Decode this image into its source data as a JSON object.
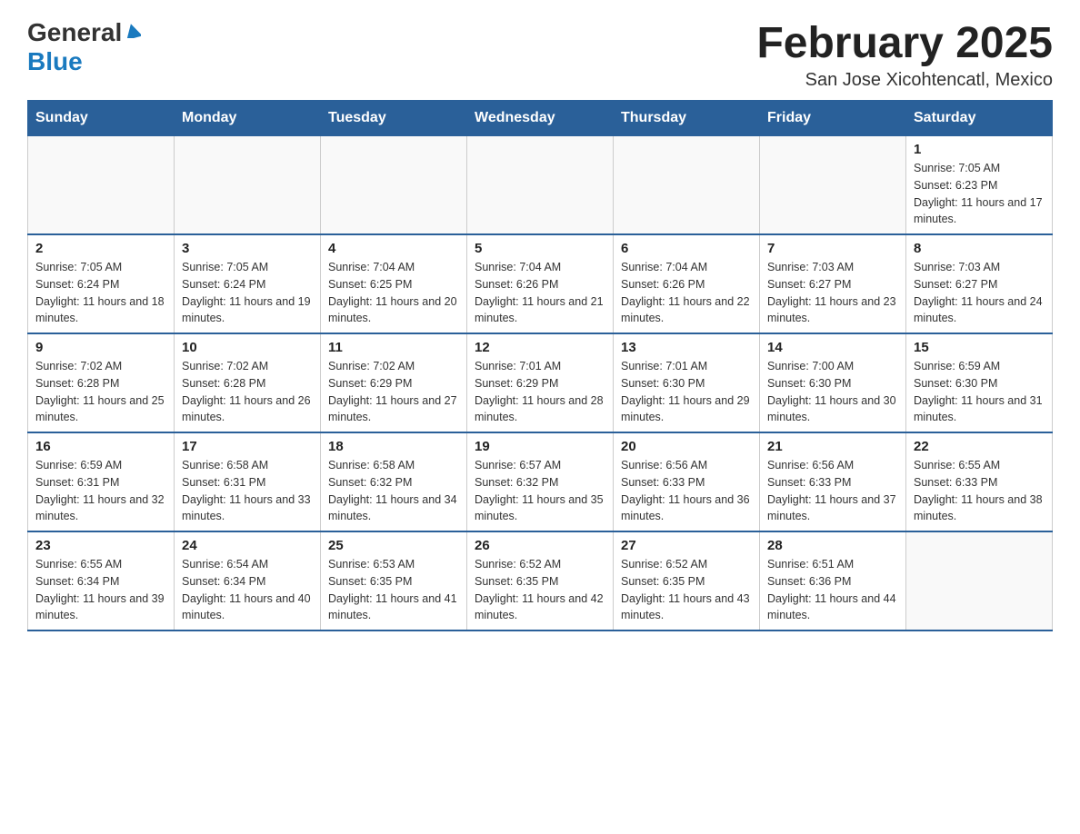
{
  "header": {
    "logo": {
      "general": "General",
      "blue": "Blue"
    },
    "title": "February 2025",
    "location": "San Jose Xicohtencatl, Mexico"
  },
  "weekdays": [
    "Sunday",
    "Monday",
    "Tuesday",
    "Wednesday",
    "Thursday",
    "Friday",
    "Saturday"
  ],
  "weeks": [
    [
      {
        "day": "",
        "info": ""
      },
      {
        "day": "",
        "info": ""
      },
      {
        "day": "",
        "info": ""
      },
      {
        "day": "",
        "info": ""
      },
      {
        "day": "",
        "info": ""
      },
      {
        "day": "",
        "info": ""
      },
      {
        "day": "1",
        "info": "Sunrise: 7:05 AM\nSunset: 6:23 PM\nDaylight: 11 hours and 17 minutes."
      }
    ],
    [
      {
        "day": "2",
        "info": "Sunrise: 7:05 AM\nSunset: 6:24 PM\nDaylight: 11 hours and 18 minutes."
      },
      {
        "day": "3",
        "info": "Sunrise: 7:05 AM\nSunset: 6:24 PM\nDaylight: 11 hours and 19 minutes."
      },
      {
        "day": "4",
        "info": "Sunrise: 7:04 AM\nSunset: 6:25 PM\nDaylight: 11 hours and 20 minutes."
      },
      {
        "day": "5",
        "info": "Sunrise: 7:04 AM\nSunset: 6:26 PM\nDaylight: 11 hours and 21 minutes."
      },
      {
        "day": "6",
        "info": "Sunrise: 7:04 AM\nSunset: 6:26 PM\nDaylight: 11 hours and 22 minutes."
      },
      {
        "day": "7",
        "info": "Sunrise: 7:03 AM\nSunset: 6:27 PM\nDaylight: 11 hours and 23 minutes."
      },
      {
        "day": "8",
        "info": "Sunrise: 7:03 AM\nSunset: 6:27 PM\nDaylight: 11 hours and 24 minutes."
      }
    ],
    [
      {
        "day": "9",
        "info": "Sunrise: 7:02 AM\nSunset: 6:28 PM\nDaylight: 11 hours and 25 minutes."
      },
      {
        "day": "10",
        "info": "Sunrise: 7:02 AM\nSunset: 6:28 PM\nDaylight: 11 hours and 26 minutes."
      },
      {
        "day": "11",
        "info": "Sunrise: 7:02 AM\nSunset: 6:29 PM\nDaylight: 11 hours and 27 minutes."
      },
      {
        "day": "12",
        "info": "Sunrise: 7:01 AM\nSunset: 6:29 PM\nDaylight: 11 hours and 28 minutes."
      },
      {
        "day": "13",
        "info": "Sunrise: 7:01 AM\nSunset: 6:30 PM\nDaylight: 11 hours and 29 minutes."
      },
      {
        "day": "14",
        "info": "Sunrise: 7:00 AM\nSunset: 6:30 PM\nDaylight: 11 hours and 30 minutes."
      },
      {
        "day": "15",
        "info": "Sunrise: 6:59 AM\nSunset: 6:30 PM\nDaylight: 11 hours and 31 minutes."
      }
    ],
    [
      {
        "day": "16",
        "info": "Sunrise: 6:59 AM\nSunset: 6:31 PM\nDaylight: 11 hours and 32 minutes."
      },
      {
        "day": "17",
        "info": "Sunrise: 6:58 AM\nSunset: 6:31 PM\nDaylight: 11 hours and 33 minutes."
      },
      {
        "day": "18",
        "info": "Sunrise: 6:58 AM\nSunset: 6:32 PM\nDaylight: 11 hours and 34 minutes."
      },
      {
        "day": "19",
        "info": "Sunrise: 6:57 AM\nSunset: 6:32 PM\nDaylight: 11 hours and 35 minutes."
      },
      {
        "day": "20",
        "info": "Sunrise: 6:56 AM\nSunset: 6:33 PM\nDaylight: 11 hours and 36 minutes."
      },
      {
        "day": "21",
        "info": "Sunrise: 6:56 AM\nSunset: 6:33 PM\nDaylight: 11 hours and 37 minutes."
      },
      {
        "day": "22",
        "info": "Sunrise: 6:55 AM\nSunset: 6:33 PM\nDaylight: 11 hours and 38 minutes."
      }
    ],
    [
      {
        "day": "23",
        "info": "Sunrise: 6:55 AM\nSunset: 6:34 PM\nDaylight: 11 hours and 39 minutes."
      },
      {
        "day": "24",
        "info": "Sunrise: 6:54 AM\nSunset: 6:34 PM\nDaylight: 11 hours and 40 minutes."
      },
      {
        "day": "25",
        "info": "Sunrise: 6:53 AM\nSunset: 6:35 PM\nDaylight: 11 hours and 41 minutes."
      },
      {
        "day": "26",
        "info": "Sunrise: 6:52 AM\nSunset: 6:35 PM\nDaylight: 11 hours and 42 minutes."
      },
      {
        "day": "27",
        "info": "Sunrise: 6:52 AM\nSunset: 6:35 PM\nDaylight: 11 hours and 43 minutes."
      },
      {
        "day": "28",
        "info": "Sunrise: 6:51 AM\nSunset: 6:36 PM\nDaylight: 11 hours and 44 minutes."
      },
      {
        "day": "",
        "info": ""
      }
    ]
  ]
}
